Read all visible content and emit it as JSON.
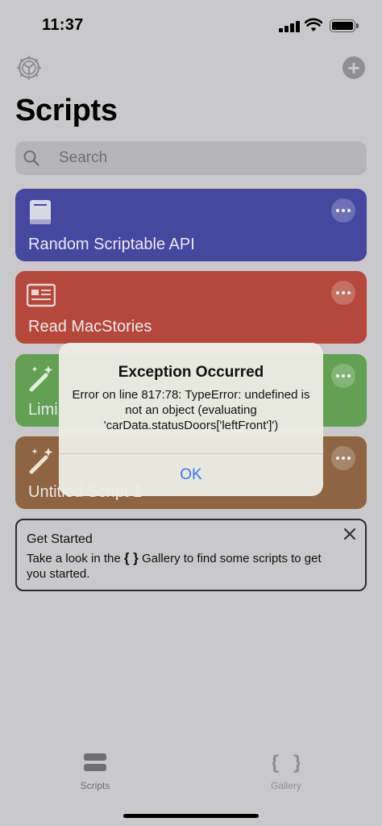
{
  "status_bar": {
    "time": "11:37"
  },
  "header": {
    "title": "Scripts"
  },
  "search": {
    "placeholder": "Search"
  },
  "scripts": [
    {
      "title": "Random Scriptable API",
      "icon": "book-icon",
      "color": "#4648a0"
    },
    {
      "title": "Read MacStories",
      "icon": "newspaper-icon",
      "color": "#b5483b"
    },
    {
      "title": "Limi",
      "icon": "magic-wand-icon",
      "color": "#62a053"
    },
    {
      "title": "Untitled Script 1",
      "icon": "magic-wand-icon",
      "color": "#8e6540"
    }
  ],
  "get_started": {
    "title": "Get Started",
    "text_before": "Take a look in the ",
    "brace_icon": "{ }",
    "text_after": " Gallery to find some scripts to get you started."
  },
  "tabs": [
    {
      "label": "Scripts",
      "icon": "stack-icon"
    },
    {
      "label": "Gallery",
      "icon": "braces-icon"
    }
  ],
  "alert": {
    "title": "Exception Occurred",
    "message": "Error on line 817:78: TypeError: undefined is not an object (evaluating 'carData.statusDoors['leftFront']')",
    "ok_label": "OK"
  },
  "colors": {
    "accent": "#3478f6",
    "background": "#c9c9cb"
  }
}
